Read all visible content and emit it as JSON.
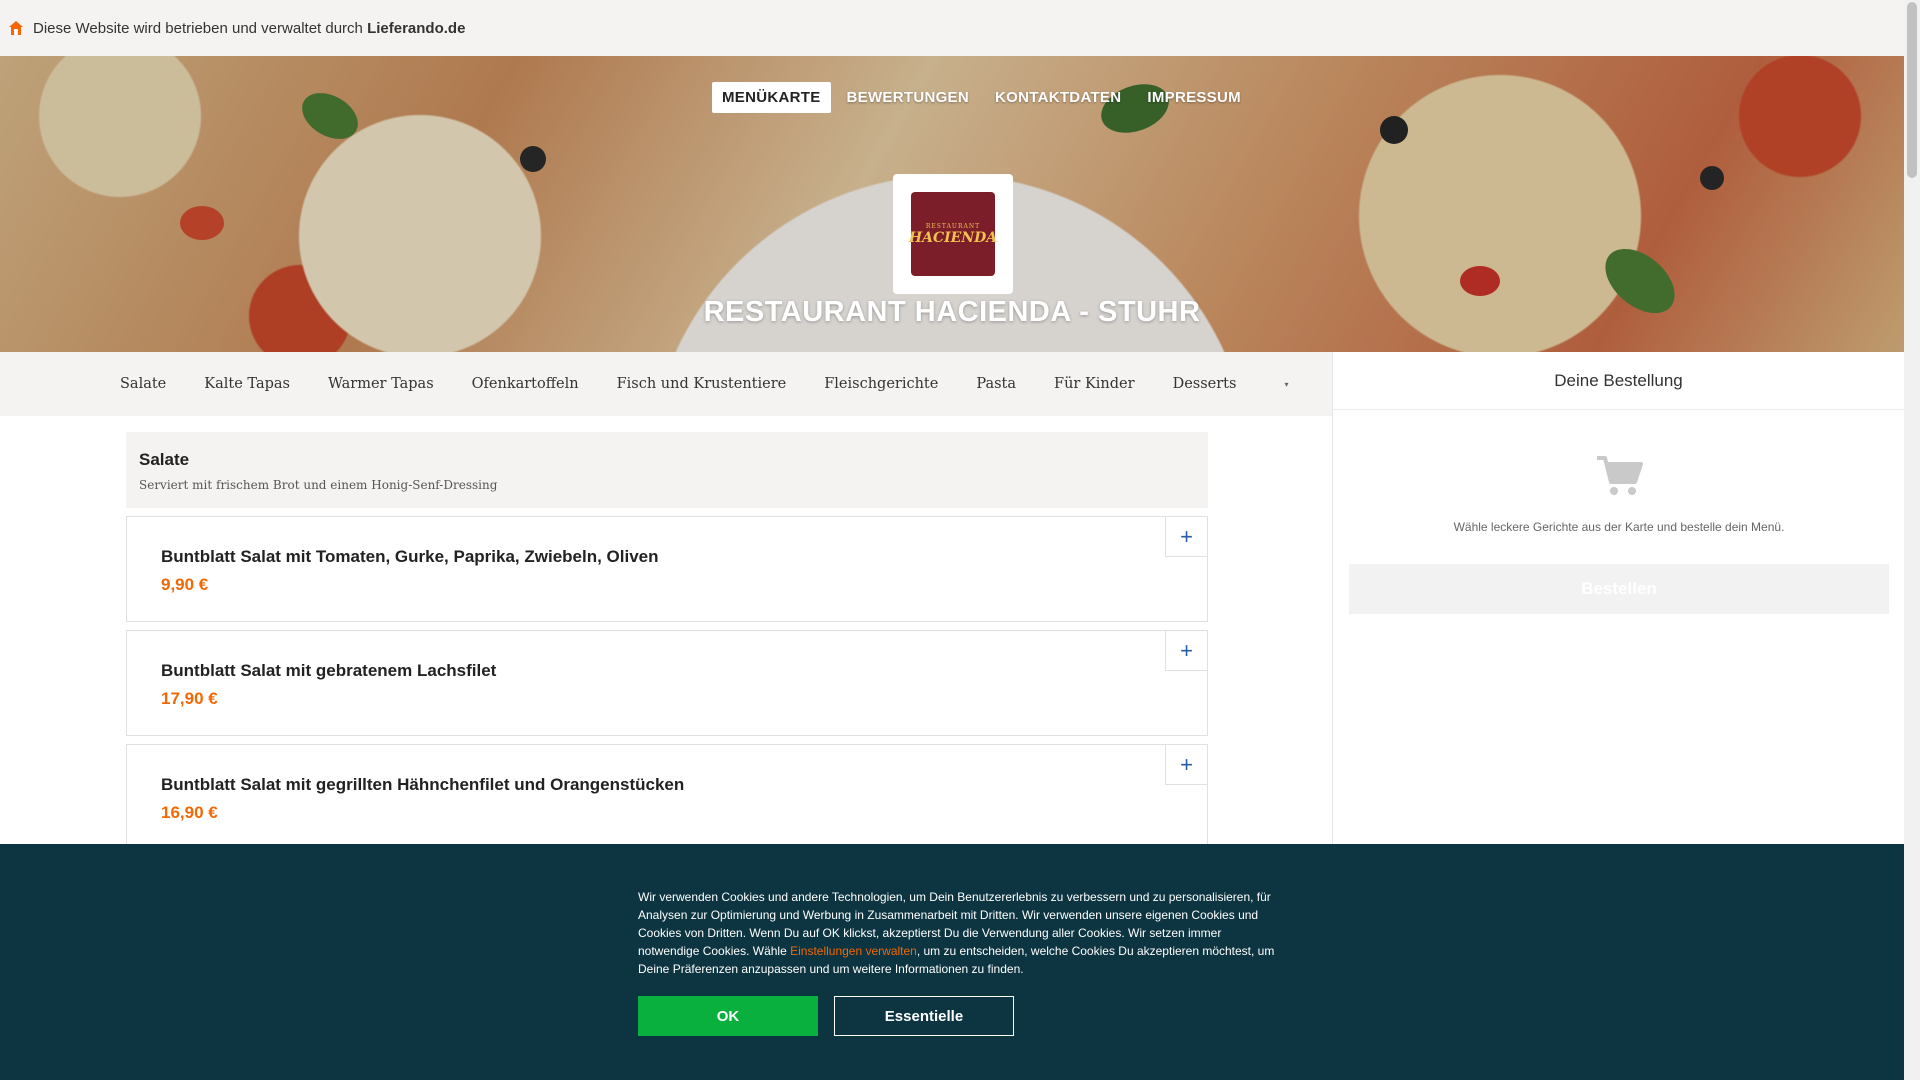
{
  "topbar": {
    "text_prefix": "Diese Website wird betrieben und verwaltet durch",
    "text_brand": "Lieferando.de",
    "icon": "home-icon"
  },
  "nav": {
    "items": [
      {
        "label": "MENÜKARTE",
        "active": true
      },
      {
        "label": "BEWERTUNGEN",
        "active": false
      },
      {
        "label": "KONTAKTDATEN",
        "active": false
      },
      {
        "label": "IMPRESSUM",
        "active": false
      }
    ]
  },
  "logo": {
    "small": "RESTAURANT",
    "big": "HACIENDA"
  },
  "restaurant": {
    "name": "RESTAURANT HACIENDA - STUHR"
  },
  "categories": {
    "items": [
      "Salate",
      "Kalte Tapas",
      "Warmer Tapas",
      "Ofenkartoffeln",
      "Fisch und Krustentiere",
      "Fleischgerichte",
      "Pasta",
      "Für Kinder",
      "Desserts"
    ],
    "more_icon": "chevron-down-icon"
  },
  "section": {
    "title": "Salate",
    "description": "Serviert mit frischem Brot und einem Honig-Senf-Dressing"
  },
  "menu_items": [
    {
      "name": "Buntblatt Salat mit Tomaten, Gurke, Paprika, Zwiebeln, Oliven",
      "price": "9,90 €",
      "add_label": "+"
    },
    {
      "name": "Buntblatt Salat mit gebratenem Lachsfilet",
      "price": "17,90 €",
      "add_label": "+"
    },
    {
      "name": "Buntblatt Salat mit gegrillten Hähnchenfilet und Orangenstücken",
      "price": "16,90 €",
      "add_label": "+"
    }
  ],
  "basket": {
    "title": "Deine Bestellung",
    "empty_text": "Wähle leckere Gerichte aus der Karte und bestelle dein Menü.",
    "order_label": "Bestellen",
    "icon": "cart-icon"
  },
  "cookie": {
    "text_before": "Wir verwenden Cookies und andere Technologien, um Dein Benutzererlebnis zu verbessern und zu personalisieren, für Analysen zur Optimierung und Werbung in Zusammenarbeit mit Dritten. Wir verwenden unsere eigenen Cookies und Cookies von Dritten. Wenn Du auf OK klickst, akzeptierst Du die Verwendung aller Cookies. Wir setzen immer notwendige Cookies. Wähle ",
    "link": "Einstellungen verwalten",
    "text_after": ", um zu entscheiden, welche Cookies Du akzeptieren möchtest, um Deine Präferenzen anzupassen und um weitere Informationen zu finden.",
    "ok_label": "OK",
    "essential_label": "Essentielle"
  },
  "colors": {
    "accent": "#f36805",
    "cookie_bg": "#0c3441",
    "ok_green": "#0ab03e",
    "plus_blue": "#2a5da8"
  }
}
